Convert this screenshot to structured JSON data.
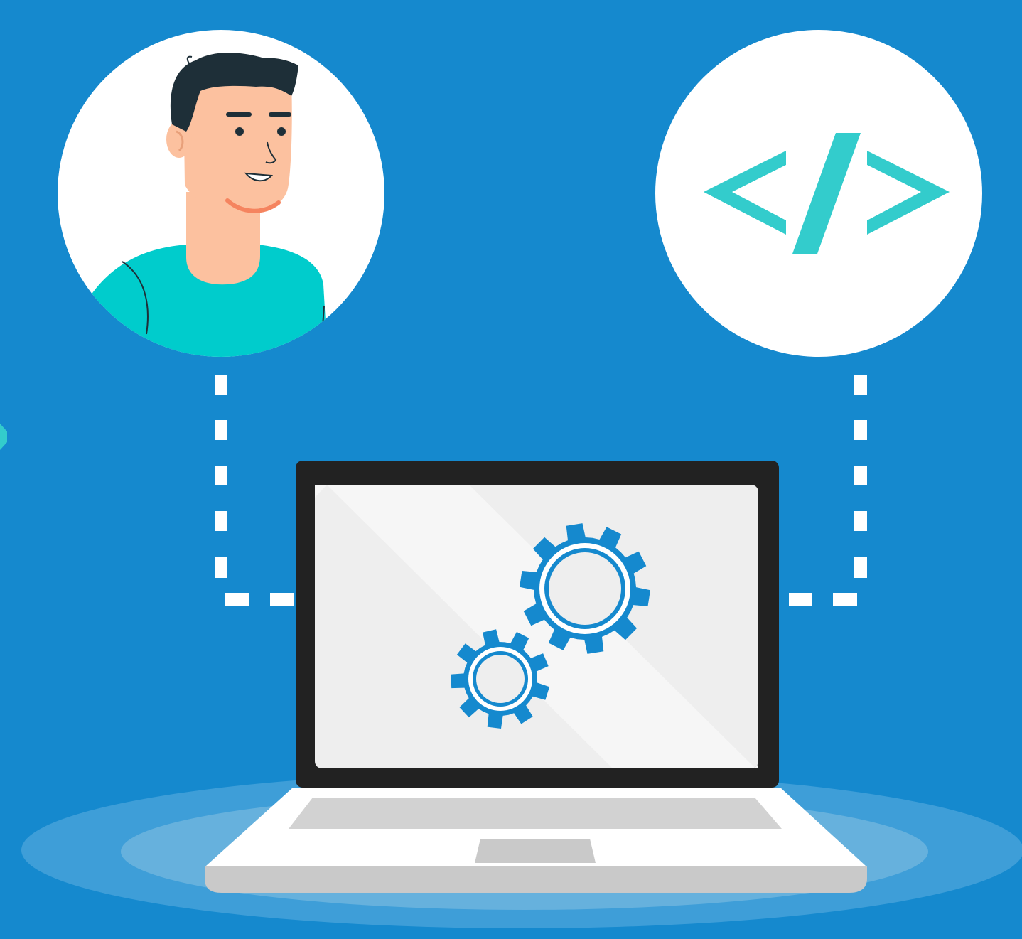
{
  "colors": {
    "background": "#1589ce",
    "circle_fill": "#ffffff",
    "connector": "#ffffff",
    "code_icon": "#33cccc",
    "gear": "#1589ce",
    "skin": "#fcc19f",
    "hair": "#1e2f38",
    "shirt": "#00cccc",
    "laptop_bezel": "#222222",
    "laptop_screen": "#eeeeee",
    "laptop_base": "#ffffff",
    "keyboard": "#d2d2d2",
    "platform_outer": "#3e9ed8",
    "platform_inner": "#66b1dd"
  },
  "icons": {
    "person": "person-avatar-icon",
    "code": "code-brackets-icon",
    "laptop": "laptop-icon",
    "gears": "gears-icon"
  }
}
